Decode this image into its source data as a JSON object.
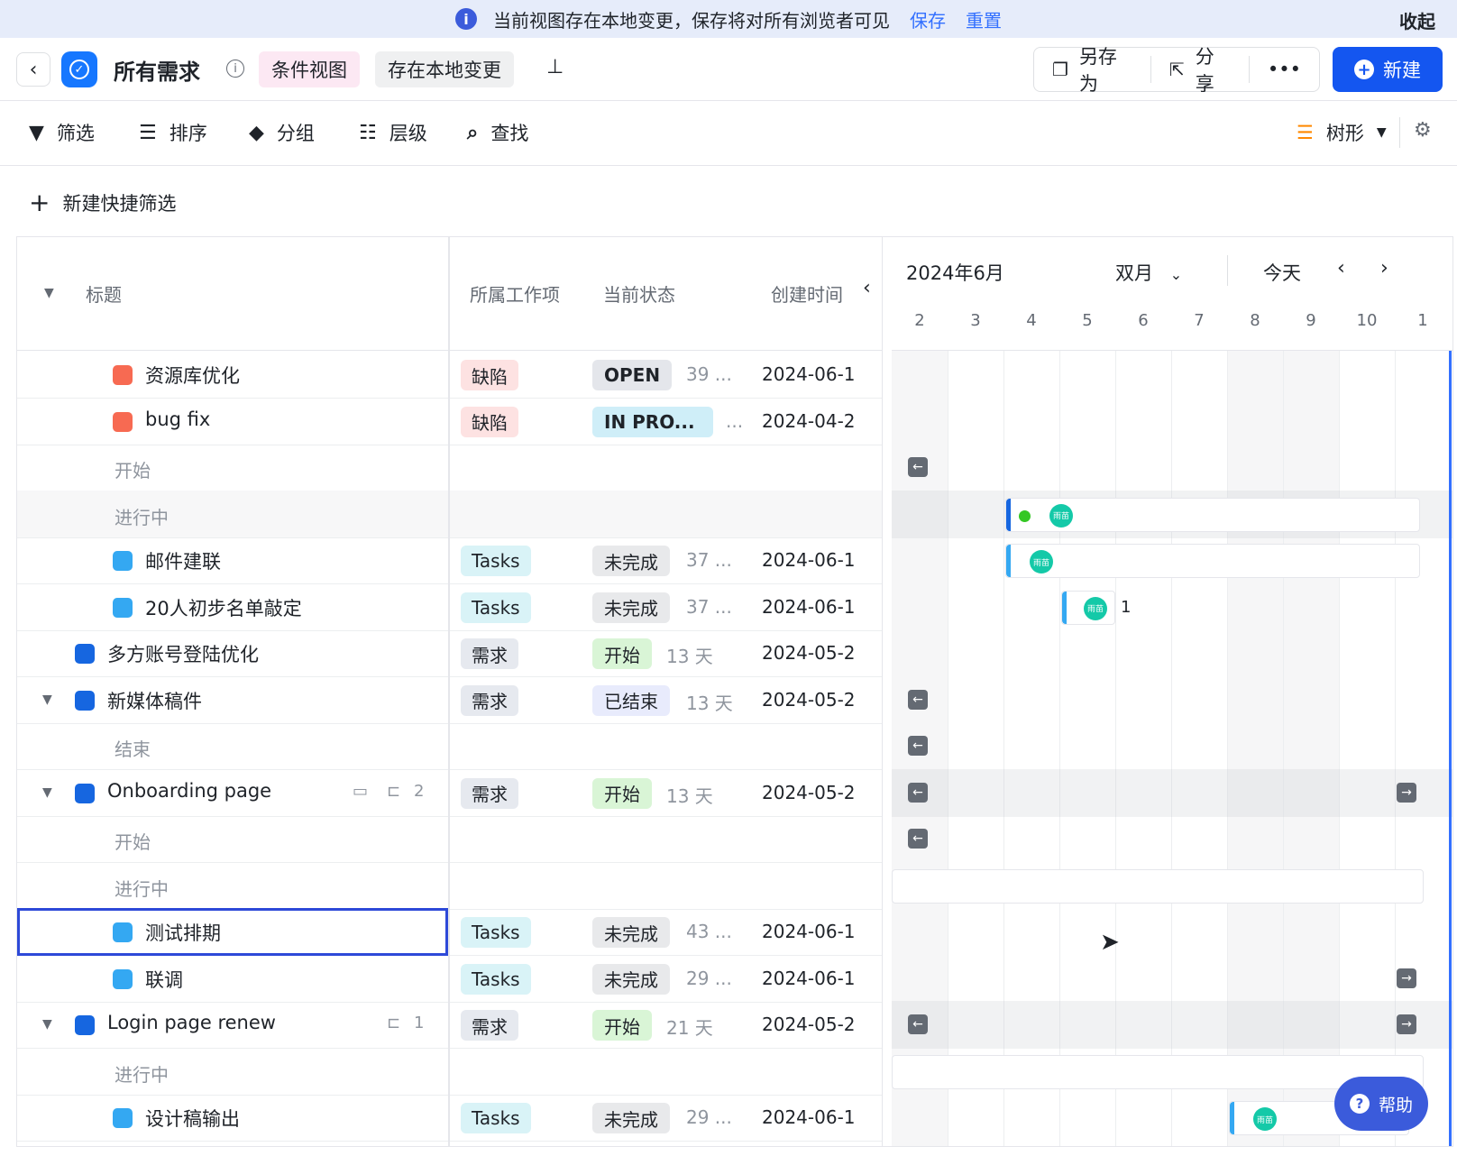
{
  "notice": {
    "message": "当前视图存在本地变更，保存将对所有浏览者可见",
    "save": "保存",
    "reset": "重置",
    "collapse": "收起"
  },
  "header": {
    "title": "所有需求",
    "chip_condition": "条件视图",
    "chip_local": "存在本地变更",
    "save_as": "另存为",
    "share": "分享",
    "more": "•••",
    "new": "新建"
  },
  "toolbar": {
    "filter": "筛选",
    "sort": "排序",
    "group": "分组",
    "level": "层级",
    "find": "查找",
    "view_mode": "树形"
  },
  "quick_filter": "新建快捷筛选",
  "columns": {
    "title": "标题",
    "work_item": "所属工作项",
    "status": "当前状态",
    "created": "创建时间"
  },
  "gantt": {
    "month": "2024年6月",
    "range": "双月",
    "today": "今天",
    "days": [
      "2",
      "3",
      "4",
      "5",
      "6",
      "7",
      "8",
      "9",
      "10",
      "1"
    ]
  },
  "rows": [
    {
      "kind": "item",
      "title": "资源库优化",
      "color": "#f76a52",
      "indent": 2,
      "type": "缺陷",
      "status": "OPEN",
      "duration": "39 ...",
      "date": "2024-06-1"
    },
    {
      "kind": "item",
      "title": "bug fix",
      "color": "#f76a52",
      "indent": 2,
      "type": "缺陷",
      "status": "IN PRO...",
      "duration": "...",
      "date": "2024-04-2"
    },
    {
      "kind": "group",
      "title": "开始"
    },
    {
      "kind": "group",
      "title": "进行中",
      "gray": true
    },
    {
      "kind": "item",
      "title": "邮件建联",
      "color": "#34a8f2",
      "indent": 2,
      "type": "Tasks",
      "status": "未完成",
      "duration": "37 ...",
      "date": "2024-06-1"
    },
    {
      "kind": "item",
      "title": "20人初步名单敲定",
      "color": "#34a8f2",
      "indent": 2,
      "type": "Tasks",
      "status": "未完成",
      "duration": "37 ...",
      "date": "2024-06-1"
    },
    {
      "kind": "item",
      "title": "多方账号登陆优化",
      "color": "#1666e0",
      "indent": 1,
      "type": "需求",
      "status": "开始",
      "duration": "13 天",
      "date": "2024-05-2"
    },
    {
      "kind": "item",
      "title": "新媒体稿件",
      "color": "#1666e0",
      "indent": 1,
      "caret": true,
      "type": "需求",
      "status": "已结束",
      "duration": "13 天",
      "date": "2024-05-2"
    },
    {
      "kind": "group",
      "title": "结束"
    },
    {
      "kind": "item",
      "title": "Onboarding page",
      "color": "#1666e0",
      "indent": 1,
      "caret": true,
      "sub_count": "2",
      "type": "需求",
      "status": "开始",
      "duration": "13 天",
      "date": "2024-05-2"
    },
    {
      "kind": "group",
      "title": "开始"
    },
    {
      "kind": "group",
      "title": "进行中"
    },
    {
      "kind": "item",
      "title": "测试排期",
      "color": "#34a8f2",
      "indent": 2,
      "selected": true,
      "type": "Tasks",
      "status": "未完成",
      "duration": "43 ...",
      "date": "2024-06-1"
    },
    {
      "kind": "item",
      "title": "联调",
      "color": "#34a8f2",
      "indent": 2,
      "type": "Tasks",
      "status": "未完成",
      "duration": "29 ...",
      "date": "2024-06-1"
    },
    {
      "kind": "item",
      "title": "Login page renew",
      "color": "#1666e0",
      "indent": 1,
      "caret": true,
      "sub_count": "1",
      "type": "需求",
      "status": "开始",
      "duration": "21 天",
      "date": "2024-05-2"
    },
    {
      "kind": "group",
      "title": "进行中"
    },
    {
      "kind": "item",
      "title": "设计稿输出",
      "color": "#34a8f2",
      "indent": 2,
      "type": "Tasks",
      "status": "未完成",
      "duration": "29 ...",
      "date": "2024-06-1"
    }
  ],
  "bar_label": "1",
  "avatar_text": "雨苗",
  "help": "帮助"
}
